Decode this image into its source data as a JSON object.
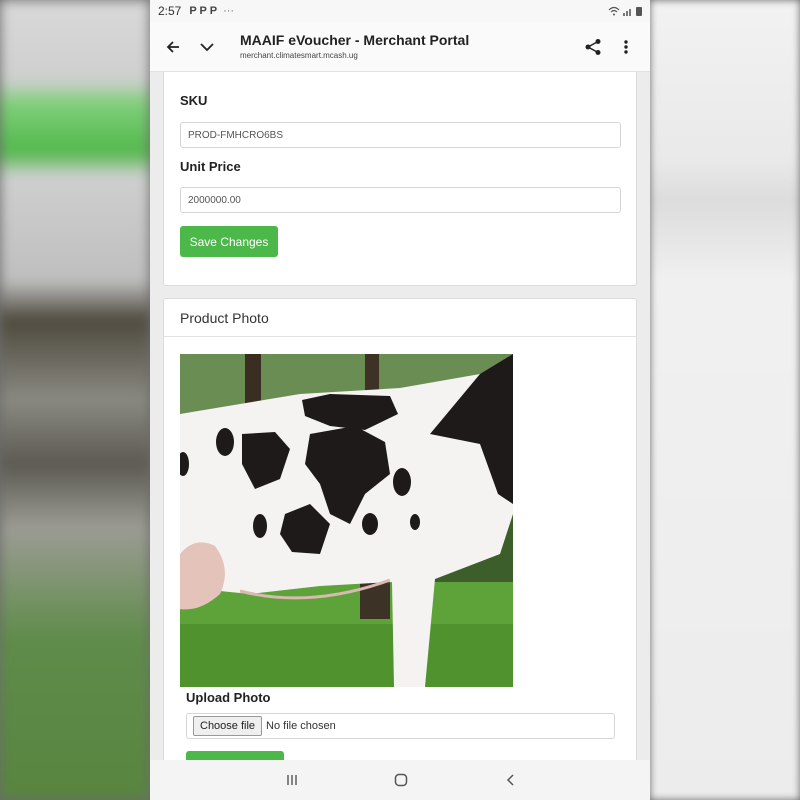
{
  "status": {
    "time": "2:57",
    "notif_icons": "P P P",
    "more": "···"
  },
  "appbar": {
    "title": "MAAIF eVoucher - Merchant Portal",
    "url": "merchant.climatesmart.mcash.ug",
    "icons": [
      "back-arrow-icon",
      "chevron-down-icon",
      "share-icon",
      "more-vert-icon"
    ]
  },
  "form": {
    "sku_label": "SKU",
    "sku_value": "PROD-FMHCRO6BS",
    "price_label": "Unit Price",
    "price_value": "2000000.00",
    "save_label": "Save Changes"
  },
  "photo_card": {
    "title": "Product Photo",
    "upload_label": "Upload Photo",
    "choose_label": "Choose file",
    "no_file": "No file chosen"
  },
  "nav": {
    "icons": [
      "recents-icon",
      "home-icon",
      "back-icon"
    ]
  },
  "colors": {
    "accent_green": "#4cb84a",
    "page_bg": "#ececec"
  }
}
